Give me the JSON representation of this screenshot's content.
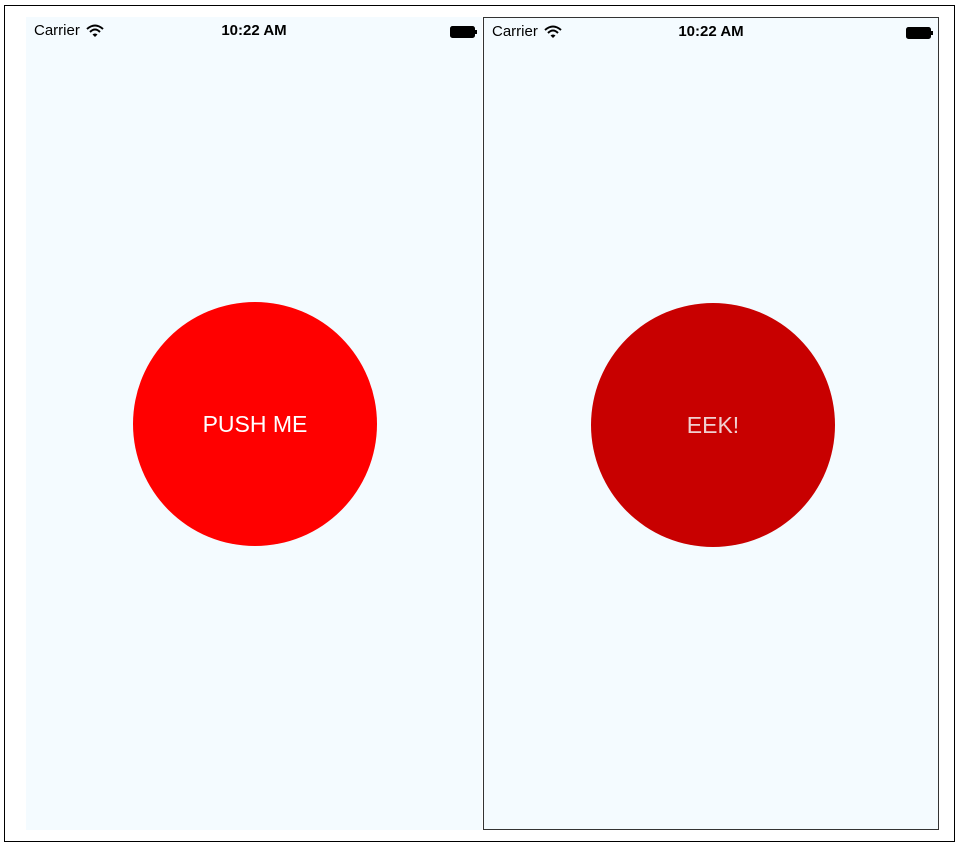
{
  "left_screen": {
    "status": {
      "carrier": "Carrier",
      "time": "10:22 AM",
      "wifi_icon": "wifi-icon",
      "battery_icon": "battery-icon"
    },
    "button": {
      "label": "PUSH ME",
      "color": "#ff0000",
      "text_color": "#ffffff"
    }
  },
  "right_screen": {
    "status": {
      "carrier": "Carrier",
      "time": "10:22 AM",
      "wifi_icon": "wifi-icon",
      "battery_icon": "battery-icon"
    },
    "button": {
      "label": "EEK!",
      "color": "#c80000",
      "text_color": "#f0d0d0"
    }
  },
  "colors": {
    "screen_background": "#f4fbff"
  }
}
